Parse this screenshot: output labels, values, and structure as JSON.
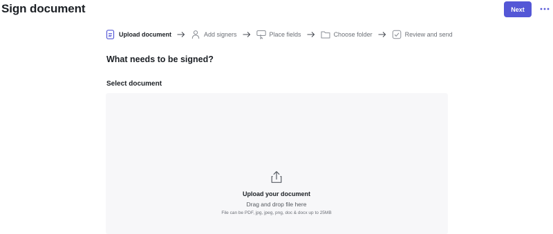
{
  "header": {
    "title": "Sign document",
    "next_label": "Next",
    "more_icon": "more-horizontal-icon"
  },
  "steps": [
    {
      "label": "Upload document",
      "icon": "document-icon",
      "active": true
    },
    {
      "label": "Add signers",
      "icon": "person-icon",
      "active": false
    },
    {
      "label": "Place fields",
      "icon": "field-icon",
      "active": false
    },
    {
      "label": "Choose folder",
      "icon": "folder-icon",
      "active": false
    },
    {
      "label": "Review and send",
      "icon": "review-check-icon",
      "active": false
    }
  ],
  "main": {
    "heading": "What needs to be signed?",
    "section_label": "Select document",
    "dropzone": {
      "icon": "upload-icon",
      "title": "Upload your document",
      "subtitle": "Drag and drop file here",
      "hint": "File can be PDF, jpg, jpeg, png, doc & docx up to 25MB"
    }
  },
  "colors": {
    "accent": "#5457d6",
    "dropzone_bg": "#f7f7f9"
  }
}
